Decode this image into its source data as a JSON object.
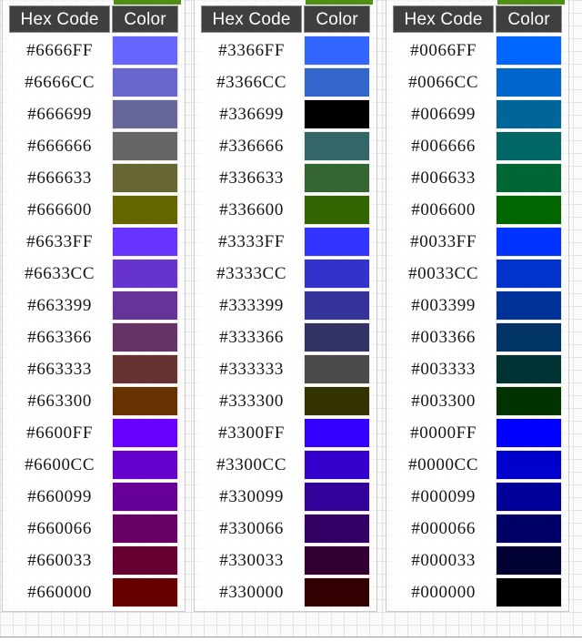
{
  "page": {
    "background_color": "#fbfbfb",
    "grid_line_color": "#e4e4e4",
    "header_bg_color": "#3f3f3f",
    "header_text_color": "#ffffff",
    "accent_green": "#4f8f12"
  },
  "columns": [
    {
      "hex_header": "Hex Code",
      "color_header": "Color"
    },
    {
      "hex_header": "Hex Code",
      "color_header": "Color"
    },
    {
      "hex_header": "Hex Code",
      "color_header": "Color"
    }
  ],
  "tables": [
    {
      "id": "table-66xxxx",
      "rows": [
        {
          "hex": "#6666FF",
          "swatch": "#6666FF"
        },
        {
          "hex": "#6666CC",
          "swatch": "#6666CC"
        },
        {
          "hex": "#666699",
          "swatch": "#666699"
        },
        {
          "hex": "#666666",
          "swatch": "#666666"
        },
        {
          "hex": "#666633",
          "swatch": "#666633"
        },
        {
          "hex": "#666600",
          "swatch": "#666600"
        },
        {
          "hex": "#6633FF",
          "swatch": "#6633FF"
        },
        {
          "hex": "#6633CC",
          "swatch": "#6633CC"
        },
        {
          "hex": "#663399",
          "swatch": "#663399"
        },
        {
          "hex": "#663366",
          "swatch": "#663366"
        },
        {
          "hex": "#663333",
          "swatch": "#663333"
        },
        {
          "hex": "#663300",
          "swatch": "#663300"
        },
        {
          "hex": "#6600FF",
          "swatch": "#6600FF"
        },
        {
          "hex": "#6600CC",
          "swatch": "#6600CC"
        },
        {
          "hex": "#660099",
          "swatch": "#660099"
        },
        {
          "hex": "#660066",
          "swatch": "#660066"
        },
        {
          "hex": "#660033",
          "swatch": "#660033"
        },
        {
          "hex": "#660000",
          "swatch": "#660000"
        }
      ]
    },
    {
      "id": "table-33xxxx",
      "rows": [
        {
          "hex": "#3366FF",
          "swatch": "#3366FF"
        },
        {
          "hex": "#3366CC",
          "swatch": "#3366CC"
        },
        {
          "hex": "#336699",
          "swatch": "#000000"
        },
        {
          "hex": "#336666",
          "swatch": "#336666"
        },
        {
          "hex": "#336633",
          "swatch": "#336633"
        },
        {
          "hex": "#336600",
          "swatch": "#336600"
        },
        {
          "hex": "#3333FF",
          "swatch": "#3333FF"
        },
        {
          "hex": "#3333CC",
          "swatch": "#3333CC"
        },
        {
          "hex": "#333399",
          "swatch": "#333399"
        },
        {
          "hex": "#333366",
          "swatch": "#333366"
        },
        {
          "hex": "#333333",
          "swatch": "#4a4a4a"
        },
        {
          "hex": "#333300",
          "swatch": "#333300"
        },
        {
          "hex": "#3300FF",
          "swatch": "#3300FF"
        },
        {
          "hex": "#3300CC",
          "swatch": "#3300CC"
        },
        {
          "hex": "#330099",
          "swatch": "#330099"
        },
        {
          "hex": "#330066",
          "swatch": "#330066"
        },
        {
          "hex": "#330033",
          "swatch": "#330033"
        },
        {
          "hex": "#330000",
          "swatch": "#330000"
        }
      ]
    },
    {
      "id": "table-00xxxx",
      "rows": [
        {
          "hex": "#0066FF",
          "swatch": "#0066FF"
        },
        {
          "hex": "#0066CC",
          "swatch": "#0066CC"
        },
        {
          "hex": "#006699",
          "swatch": "#006699"
        },
        {
          "hex": "#006666",
          "swatch": "#006666"
        },
        {
          "hex": "#006633",
          "swatch": "#006633"
        },
        {
          "hex": "#006600",
          "swatch": "#006600"
        },
        {
          "hex": "#0033FF",
          "swatch": "#0033FF"
        },
        {
          "hex": "#0033CC",
          "swatch": "#0033CC"
        },
        {
          "hex": "#003399",
          "swatch": "#003399"
        },
        {
          "hex": "#003366",
          "swatch": "#003366"
        },
        {
          "hex": "#003333",
          "swatch": "#003333"
        },
        {
          "hex": "#003300",
          "swatch": "#003300"
        },
        {
          "hex": "#0000FF",
          "swatch": "#0000FF"
        },
        {
          "hex": "#0000CC",
          "swatch": "#0000CC"
        },
        {
          "hex": "#000099",
          "swatch": "#000099"
        },
        {
          "hex": "#000066",
          "swatch": "#000066"
        },
        {
          "hex": "#000033",
          "swatch": "#000033"
        },
        {
          "hex": "#000000",
          "swatch": "#000000"
        }
      ]
    }
  ]
}
